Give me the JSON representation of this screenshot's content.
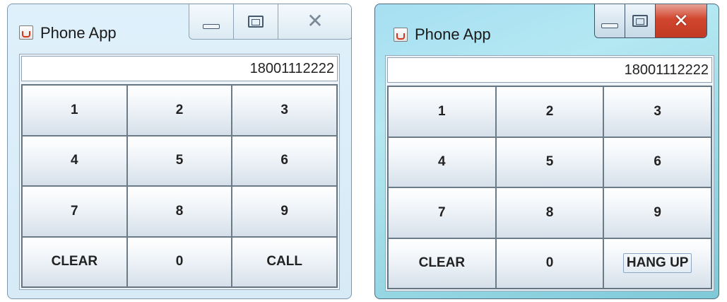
{
  "windows": [
    {
      "title": "Phone App",
      "display": "18001112222",
      "keys": [
        "1",
        "2",
        "3",
        "4",
        "5",
        "6",
        "7",
        "8",
        "9",
        "CLEAR",
        "0",
        "CALL"
      ]
    },
    {
      "title": "Phone App",
      "display": "18001112222",
      "keys": [
        "1",
        "2",
        "3",
        "4",
        "5",
        "6",
        "7",
        "8",
        "9",
        "CLEAR",
        "0",
        "HANG UP"
      ]
    }
  ],
  "icons": {
    "app": "java-cup-icon",
    "minimize": "minimize-icon",
    "maximize": "maximize-icon",
    "close": "close-icon"
  },
  "colors": {
    "close_active": "#c9412a",
    "window_frame": "#a7dff2"
  }
}
